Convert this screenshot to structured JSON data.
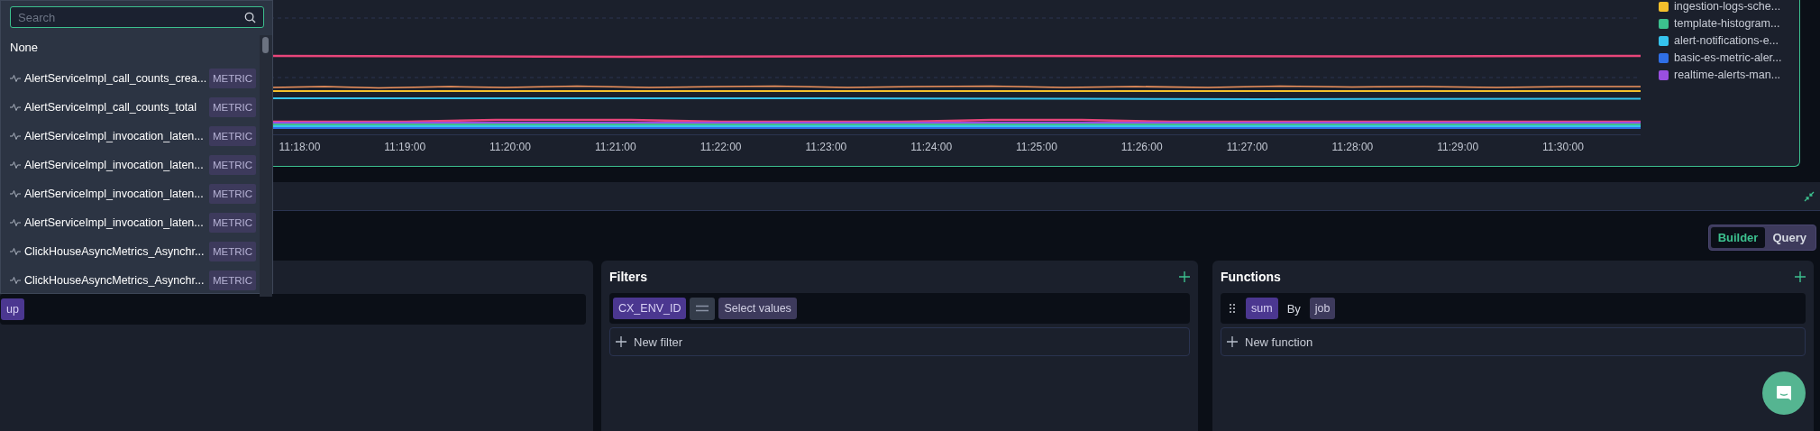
{
  "chart": {
    "x_ticks": [
      "11:18:00",
      "11:19:00",
      "11:20:00",
      "11:21:00",
      "11:22:00",
      "11:23:00",
      "11:24:00",
      "11:25:00",
      "11:26:00",
      "11:27:00",
      "11:28:00",
      "11:29:00",
      "11:30:00"
    ],
    "legend": [
      {
        "label": "ingestion-logs-sche...",
        "color": "#f5c02c"
      },
      {
        "label": "template-histogram...",
        "color": "#3cc08e"
      },
      {
        "label": "alert-notifications-e...",
        "color": "#35c3ee"
      },
      {
        "label": "basic-es-metric-aler...",
        "color": "#2f6fe6"
      },
      {
        "label": "realtime-alerts-man...",
        "color": "#9a4fe0"
      }
    ]
  },
  "view_toggle": [
    {
      "label": "Builder",
      "selected": true
    },
    {
      "label": "Query",
      "selected": false
    }
  ],
  "metric_panel": {
    "metric": "up"
  },
  "filters": {
    "title": "Filters",
    "rows": [
      {
        "key": "CX_ENV_ID",
        "value_placeholder": "Select values"
      }
    ],
    "new_label": "New filter"
  },
  "functions": {
    "title": "Functions",
    "rows": [
      {
        "fn": "sum",
        "by_label": "By",
        "by": "job"
      }
    ],
    "new_label": "New function"
  },
  "dropdown": {
    "search": {
      "placeholder": "Search"
    },
    "none_option": "None",
    "items": [
      {
        "label": "AlertServiceImpl_call_counts_crea...",
        "tag": "METRIC"
      },
      {
        "label": "AlertServiceImpl_call_counts_total",
        "tag": "METRIC"
      },
      {
        "label": "AlertServiceImpl_invocation_laten...",
        "tag": "METRIC"
      },
      {
        "label": "AlertServiceImpl_invocation_laten...",
        "tag": "METRIC"
      },
      {
        "label": "AlertServiceImpl_invocation_laten...",
        "tag": "METRIC"
      },
      {
        "label": "AlertServiceImpl_invocation_laten...",
        "tag": "METRIC"
      },
      {
        "label": "ClickHouseAsyncMetrics_Asynchr...",
        "tag": "METRIC"
      },
      {
        "label": "ClickHouseAsyncMetrics_Asynchr...",
        "tag": "METRIC"
      }
    ]
  }
}
